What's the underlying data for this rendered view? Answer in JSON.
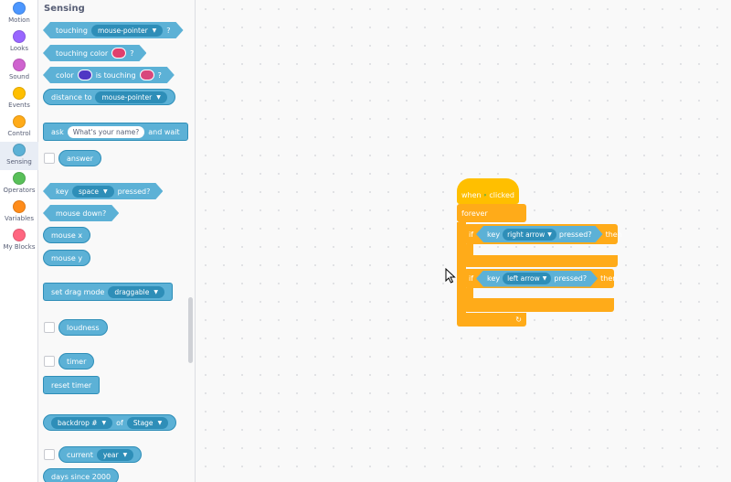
{
  "categories": [
    {
      "label": "Motion",
      "color": "#4c97ff"
    },
    {
      "label": "Looks",
      "color": "#9966ff"
    },
    {
      "label": "Sound",
      "color": "#cf63cf"
    },
    {
      "label": "Events",
      "color": "#ffbf00"
    },
    {
      "label": "Control",
      "color": "#ffab19"
    },
    {
      "label": "Sensing",
      "color": "#5cb1d6"
    },
    {
      "label": "Operators",
      "color": "#59c059"
    },
    {
      "label": "Variables",
      "color": "#ff8c1a"
    },
    {
      "label": "My Blocks",
      "color": "#ff6680"
    }
  ],
  "palette": {
    "title": "Sensing",
    "touching": {
      "label": "touching",
      "option": "mouse-pointer",
      "q": "?"
    },
    "touching_color": {
      "label": "touching color",
      "color": "#e03f6d",
      "q": "?"
    },
    "color_touching": {
      "label": "color",
      "color1": "#4f37c4",
      "mid": "is touching",
      "color2": "#d8487c",
      "q": "?"
    },
    "distance_to": {
      "label": "distance to",
      "option": "mouse-pointer"
    },
    "ask": {
      "label": "ask",
      "input": "What's your name?",
      "suffix": "and wait"
    },
    "answer": "answer",
    "key_pressed": {
      "label": "key",
      "option": "space",
      "suffix": "pressed?"
    },
    "mouse_down": "mouse down?",
    "mouse_x": "mouse x",
    "mouse_y": "mouse y",
    "drag_mode": {
      "label": "set drag mode",
      "option": "draggable"
    },
    "loudness": "loudness",
    "timer": "timer",
    "reset_timer": "reset timer",
    "backdrop_of": {
      "option1": "backdrop #",
      "mid": "of",
      "option2": "Stage"
    },
    "current": {
      "label": "current",
      "option": "year"
    },
    "days_since": "days since 2000"
  },
  "script": {
    "hat": {
      "prefix": "when",
      "suffix": "clicked"
    },
    "forever": "forever",
    "if1": {
      "if": "if",
      "key": "key",
      "option": "right arrow",
      "pressed": "pressed?",
      "then": "then"
    },
    "if2": {
      "if": "if",
      "key": "key",
      "option": "left arrow",
      "pressed": "pressed?",
      "then": "then"
    }
  }
}
